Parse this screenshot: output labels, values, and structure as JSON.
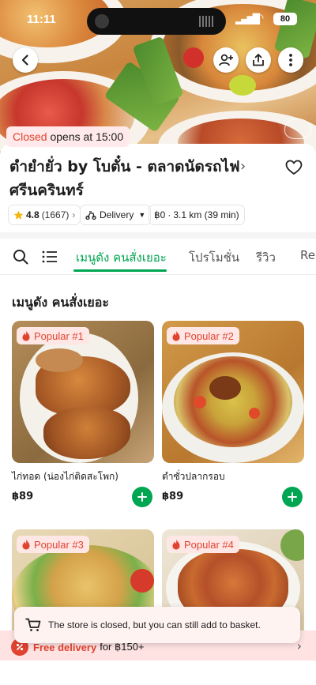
{
  "status_bar": {
    "time": "11:11",
    "battery": "80"
  },
  "store": {
    "status_word": "Closed",
    "status_rest": "opens at 15:00",
    "name": "ตำยำยั่ว by โบตั๋น - ตลาดนัดรถไฟ ศรีนครินทร์",
    "rating": "4.8",
    "rating_count": "(1667)",
    "delivery_label": "Delivery",
    "delivery_fee": "฿0",
    "distance": "3.1 km (39 min)"
  },
  "tabs": [
    {
      "label": "เมนูดัง คนสั่งเยอะ",
      "active": true
    },
    {
      "label": "โปรโมชั่น",
      "active": false
    },
    {
      "label": "รีวิว",
      "active": false
    },
    {
      "label": "Rec",
      "active": false
    }
  ],
  "section_title": "เมนูดัง คนสั่งเยอะ",
  "menu_items": [
    {
      "badge": "Popular #1",
      "name": "ไก่ทอด (น่องไก่ติดสะโพก)",
      "price": "฿89"
    },
    {
      "badge": "Popular #2",
      "name": "ตำซั่วปลากรอบ",
      "price": "฿89"
    },
    {
      "badge": "Popular #3"
    },
    {
      "badge": "Popular #4"
    }
  ],
  "toast": {
    "message": "The store is closed, but you can still add to basket."
  },
  "banner": {
    "strong": "Free delivery",
    "rest": "for ฿150+"
  },
  "colors": {
    "brand_green": "#00a651",
    "closed_red": "#e2432f",
    "badge_bg": "#ffe7e6"
  },
  "icons": [
    "back-icon",
    "group-order-icon",
    "share-icon",
    "more-icon",
    "heart-icon",
    "star-icon",
    "search-icon",
    "list-icon",
    "fire-icon",
    "plus-icon",
    "basket-icon",
    "discount-icon",
    "chevron-right-icon"
  ]
}
